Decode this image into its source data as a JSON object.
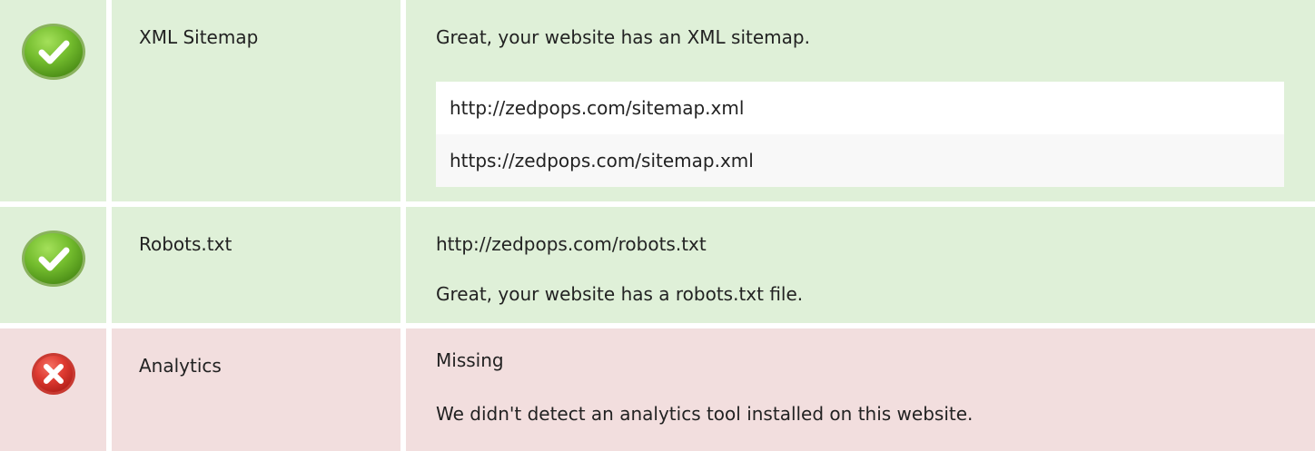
{
  "rows": [
    {
      "status": "pass",
      "icon": "check-circle-icon",
      "name": "XML Sitemap",
      "message": "Great, your website has an XML sitemap.",
      "urls": [
        "http://zedpops.com/sitemap.xml",
        "https://zedpops.com/sitemap.xml"
      ]
    },
    {
      "status": "pass",
      "icon": "check-circle-icon",
      "name": "Robots.txt",
      "url": "http://zedpops.com/robots.txt",
      "message": "Great, your website has a robots.txt file."
    },
    {
      "status": "fail",
      "icon": "cross-circle-icon",
      "name": "Analytics",
      "result": "Missing",
      "message": "We didn't detect an analytics tool installed on this website."
    }
  ],
  "colors": {
    "pass_background": "#dff0d8",
    "fail_background": "#f2dede",
    "pass_icon": "#70b62c",
    "fail_icon": "#d9322c"
  }
}
